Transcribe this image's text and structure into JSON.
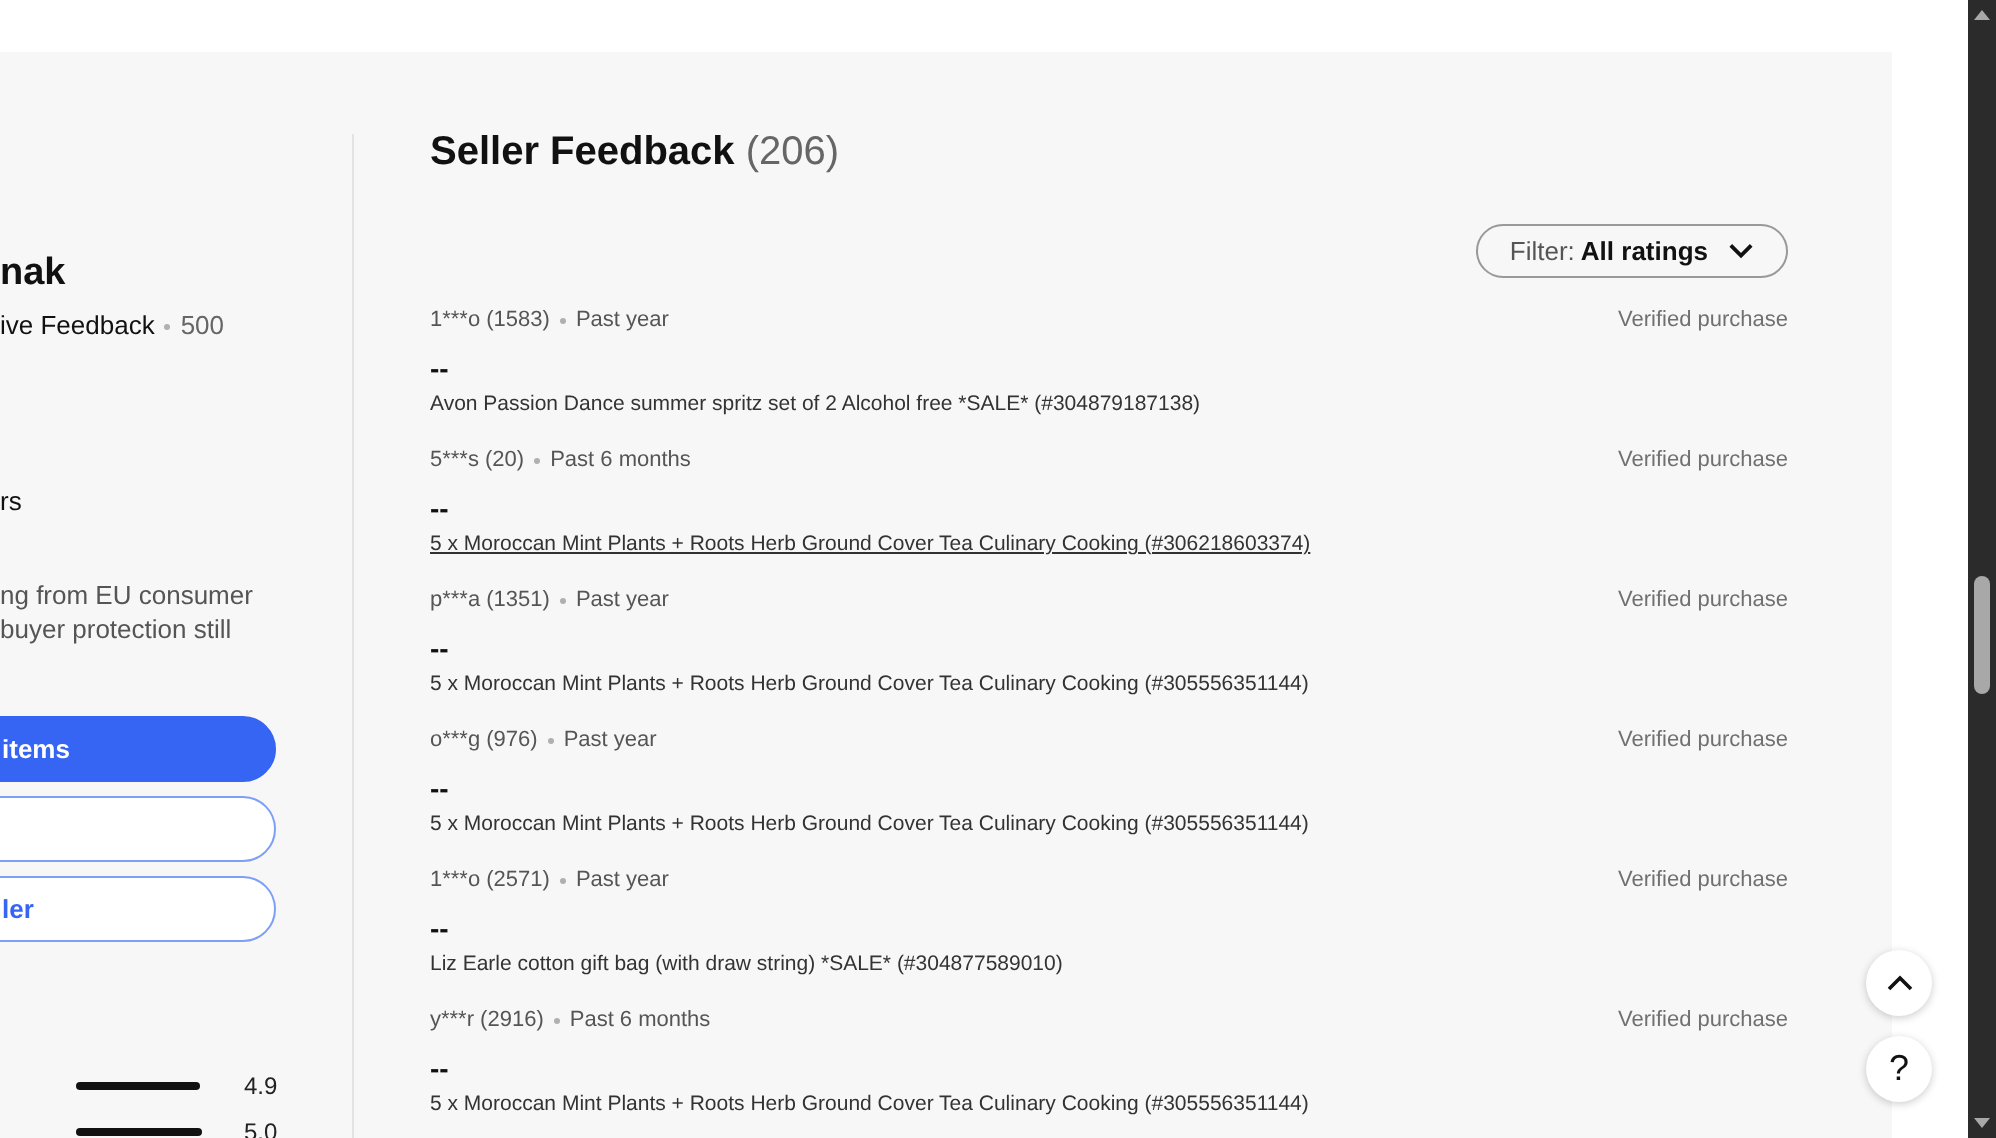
{
  "seller_panel": {
    "name": "nak",
    "feedback_label": "ive Feedback",
    "feedback_count": "500",
    "line_3": "rs",
    "notice": [
      "ng from EU consumer",
      "buyer protection still"
    ],
    "buttons": [
      {
        "label": "items",
        "kind": "primary"
      },
      {
        "kind": "outline"
      },
      {
        "label": "ler",
        "kind": "outline"
      }
    ],
    "ratings": [
      {
        "level": 0.98,
        "value": "4.9"
      },
      {
        "level": 1.0,
        "value": "5.0"
      }
    ]
  },
  "feedback": {
    "title": "Seller Feedback",
    "count": "(206)",
    "filter": {
      "label": "Filter:",
      "value": "All ratings"
    },
    "entries": [
      {
        "user": "1***o (1583)",
        "time": "Past year",
        "badge": "Verified purchase",
        "comment": "--",
        "item": "Avon Passion Dance summer spritz set of 2 Alcohol free *SALE* (#304879187138)",
        "hovered": false
      },
      {
        "user": "5***s (20)",
        "time": "Past 6 months",
        "badge": "Verified purchase",
        "comment": "--",
        "item": "5 x Moroccan Mint Plants + Roots Herb Ground Cover Tea Culinary Cooking (#306218603374)",
        "hovered": true
      },
      {
        "user": "p***a (1351)",
        "time": "Past year",
        "badge": "Verified purchase",
        "comment": "--",
        "item": "5 x Moroccan Mint Plants + Roots Herb Ground Cover Tea Culinary Cooking (#305556351144)",
        "hovered": false
      },
      {
        "user": "o***g (976)",
        "time": "Past year",
        "badge": "Verified purchase",
        "comment": "--",
        "item": "5 x Moroccan Mint Plants + Roots Herb Ground Cover Tea Culinary Cooking (#305556351144)",
        "hovered": false
      },
      {
        "user": "1***o (2571)",
        "time": "Past year",
        "badge": "Verified purchase",
        "comment": "--",
        "item": "Liz Earle cotton gift bag (with draw string) *SALE* (#304877589010)",
        "hovered": false
      },
      {
        "user": "y***r (2916)",
        "time": "Past 6 months",
        "badge": "Verified purchase",
        "comment": "--",
        "item": "5 x Moroccan Mint Plants + Roots Herb Ground Cover Tea Culinary Cooking (#305556351144)",
        "hovered": false
      }
    ]
  },
  "floating_buttons": [
    {
      "kind": "top"
    },
    {
      "label": "?",
      "kind": "help"
    }
  ]
}
